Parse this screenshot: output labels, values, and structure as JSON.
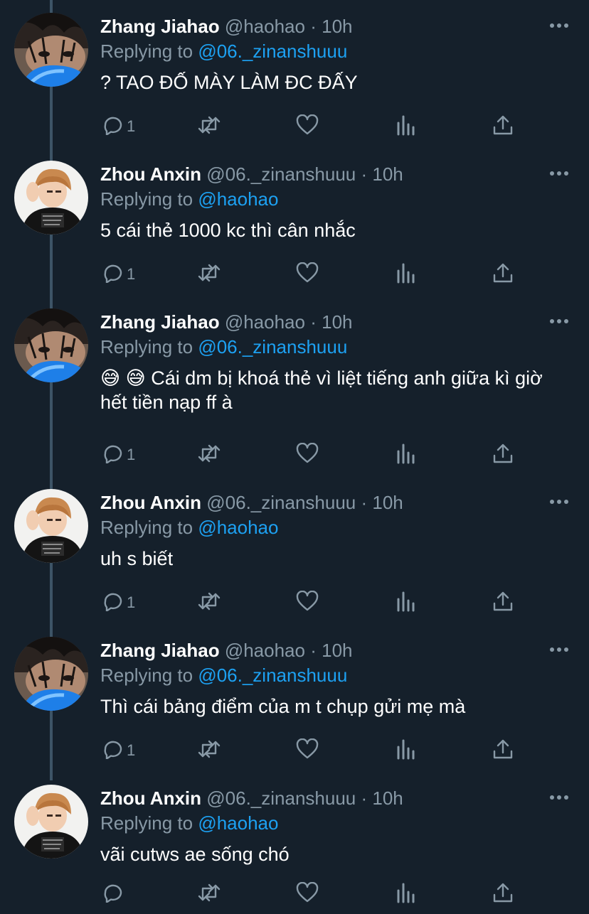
{
  "tweets": [
    {
      "author": "zhang",
      "display_name": "Zhang Jiahao",
      "handle": "@haohao",
      "dot": "·",
      "time": "10h",
      "replying_label": "Replying to",
      "replying_to": "@06._zinanshuuu",
      "text": "? TAO ĐỐ MÀY LÀM ĐC ĐẤY",
      "reply_count": "1"
    },
    {
      "author": "zhou",
      "display_name": "Zhou Anxin",
      "handle": "@06._zinanshuuu",
      "dot": "·",
      "time": "10h",
      "replying_label": "Replying to",
      "replying_to": "@haohao",
      "text": "5 cái thẻ 1000 kc thì cân nhắc",
      "reply_count": "1"
    },
    {
      "author": "zhang",
      "display_name": "Zhang Jiahao",
      "handle": "@haohao",
      "dot": "·",
      "time": "10h",
      "replying_label": "Replying to",
      "replying_to": "@06._zinanshuuu",
      "text": "😅 😅  Cái dm bị khoá thẻ vì liệt tiếng anh giữa kì giờ hết tiền nạp ff à",
      "reply_count": "1"
    },
    {
      "author": "zhou",
      "display_name": "Zhou Anxin",
      "handle": "@06._zinanshuuu",
      "dot": "·",
      "time": "10h",
      "replying_label": "Replying to",
      "replying_to": "@haohao",
      "text": "uh s biết",
      "reply_count": "1"
    },
    {
      "author": "zhang",
      "display_name": "Zhang Jiahao",
      "handle": "@haohao",
      "dot": "·",
      "time": "10h",
      "replying_label": "Replying to",
      "replying_to": "@06._zinanshuuu",
      "text": "Thì cái bảng điểm của m t chụp gửi mẹ mà",
      "reply_count": "1"
    },
    {
      "author": "zhou",
      "display_name": "Zhou Anxin",
      "handle": "@06._zinanshuuu",
      "dot": "·",
      "time": "10h",
      "replying_label": "Replying to",
      "replying_to": "@haohao",
      "text": "vãi cutws ae sống chó",
      "reply_count": ""
    }
  ],
  "icons": {
    "reply": "reply-icon",
    "retweet": "retweet-icon",
    "like": "heart-icon",
    "analytics": "analytics-icon",
    "share": "share-icon",
    "more": "more-icon"
  },
  "colors": {
    "background": "#15202b",
    "secondary_text": "#8899a6",
    "accent": "#1da1f2",
    "thread_line": "#3d5466"
  }
}
